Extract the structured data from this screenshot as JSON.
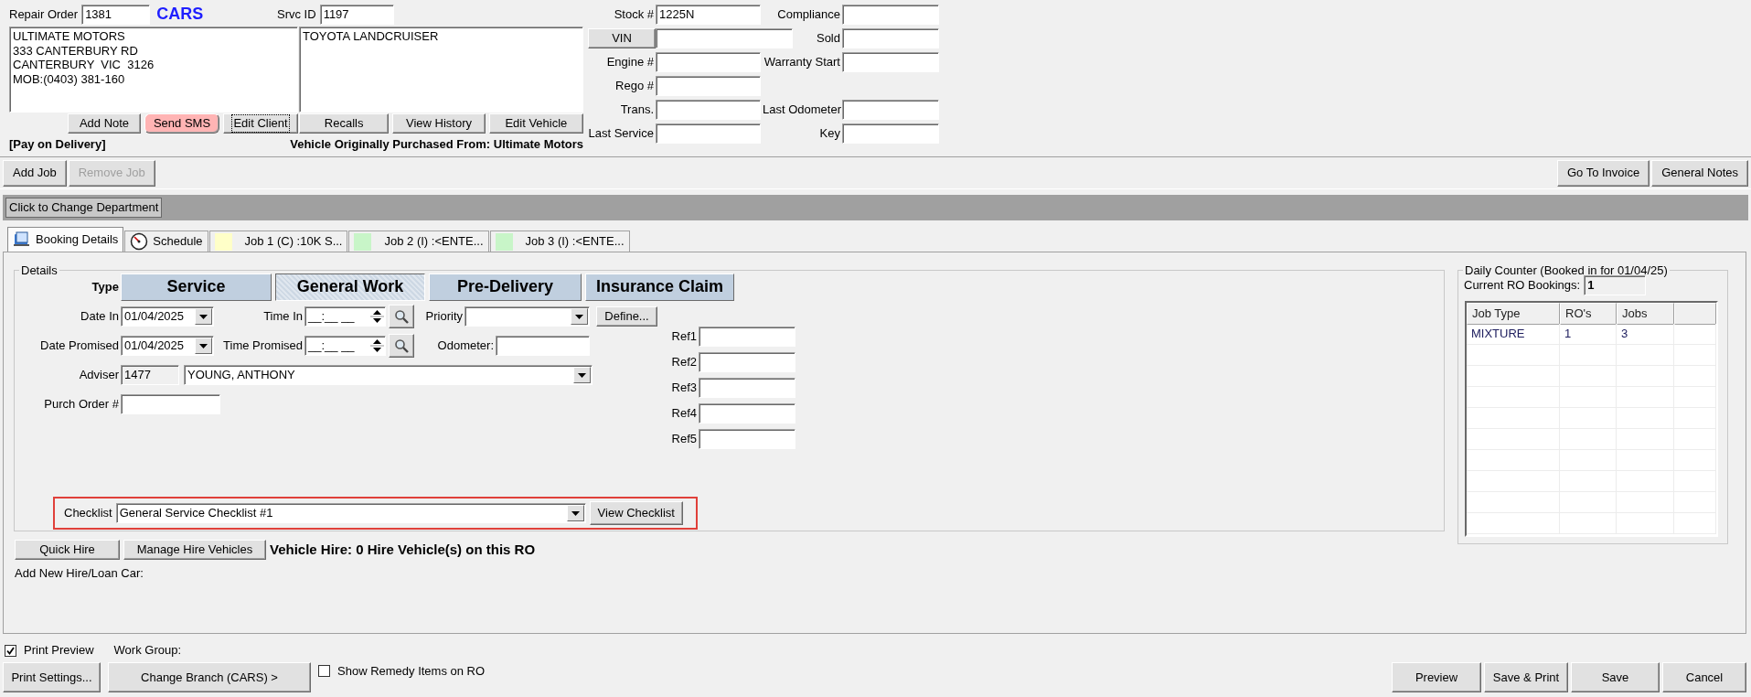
{
  "header": {
    "repair_order_label": "Repair Order",
    "repair_order": "1381",
    "branch": "CARS",
    "srvc_id_label": "Srvc ID",
    "srvc_id": "1197",
    "client_lines": [
      "ULTIMATE MOTORS",
      "333 CANTERBURY RD",
      "CANTERBURY  VIC  3126",
      "MOB:(0403) 381-160"
    ],
    "client_buttons": [
      {
        "label": "Add Note",
        "kind": "plain"
      },
      {
        "label": "Send SMS",
        "kind": "alert"
      },
      {
        "label": "Edit Client",
        "kind": "focused"
      }
    ],
    "payment_note": "[Pay on Delivery]",
    "vehicle_lines": [
      "TOYOTA LANDCRUISER"
    ],
    "vehicle_buttons": [
      {
        "label": "Recalls",
        "kind": "plain"
      },
      {
        "label": "View History",
        "kind": "plain"
      },
      {
        "label": "Edit Vehicle",
        "kind": "plain"
      }
    ],
    "purchased_from": "Vehicle Originally Purchased From: Ultimate Motors"
  },
  "vehicle_rows": [
    {
      "left": {
        "label": "Stock #",
        "kind": "label",
        "value": "1225N"
      },
      "right": {
        "label": "Compliance"
      }
    },
    {
      "left": {
        "label": "VIN",
        "kind": "button"
      },
      "right": {
        "label": "Sold"
      }
    },
    {
      "left": {
        "label": "Engine #",
        "kind": "label"
      },
      "right": {
        "label": "Warranty Start"
      }
    },
    {
      "left": {
        "label": "Rego #",
        "kind": "label"
      }
    },
    {
      "left": {
        "label": "Trans.",
        "kind": "label"
      },
      "right": {
        "label": "Last Odometer"
      }
    },
    {
      "left": {
        "label": "Last Service",
        "kind": "label"
      },
      "right": {
        "label": "Key"
      }
    }
  ],
  "toolbar": {
    "left": [
      {
        "label": "Add Job",
        "disabled": false
      },
      {
        "label": "Remove Job",
        "disabled": true
      }
    ],
    "right": [
      {
        "label": "Go To Invoice",
        "disabled": false
      },
      {
        "label": "General Notes",
        "disabled": false
      }
    ]
  },
  "department_button": "Click to Change Department",
  "tabs": [
    {
      "label": "Booking Details",
      "kind": "booking",
      "selected": true
    },
    {
      "label": "Schedule",
      "kind": "schedule",
      "selected": false
    },
    {
      "label": "Job 1 (C) :10K S...",
      "kind": "job",
      "color": "#ffffc8",
      "selected": false
    },
    {
      "label": "Job 2 (I) :<ENTE...",
      "kind": "job",
      "color": "#c8f5c8",
      "selected": false
    },
    {
      "label": "Job 3 (I) :<ENTE...",
      "kind": "job",
      "color": "#c8f5c8",
      "selected": false
    }
  ],
  "details": {
    "title": "Details",
    "type_label": "Type",
    "types": [
      {
        "label": "Service",
        "selected": false
      },
      {
        "label": "General Work",
        "selected": true
      },
      {
        "label": "Pre-Delivery",
        "selected": false
      },
      {
        "label": "Insurance Claim",
        "selected": false
      }
    ],
    "date_in": {
      "label": "Date In",
      "value": "01/04/2025"
    },
    "time_in": {
      "label": "Time In",
      "value": "__:__ __"
    },
    "priority": {
      "label": "Priority"
    },
    "define_button": "Define...",
    "date_promised": {
      "label": "Date Promised",
      "value": "01/04/2025"
    },
    "time_promised": {
      "label": "Time Promised",
      "value": "__:__ __"
    },
    "odometer": {
      "label": "Odometer:"
    },
    "adviser": {
      "label": "Adviser",
      "code": "1477",
      "name": "YOUNG, ANTHONY"
    },
    "purch_order": {
      "label": "Purch Order #"
    },
    "refs": [
      "Ref1",
      "Ref2",
      "Ref3",
      "Ref4",
      "Ref5"
    ],
    "checklist": {
      "label": "Checklist",
      "value": "General Service Checklist #1",
      "button": "View Checklist",
      "highlighted": true
    }
  },
  "hire": {
    "buttons": [
      "Quick Hire",
      "Manage Hire Vehicles"
    ],
    "summary": "Vehicle Hire: 0 Hire Vehicle(s) on this RO",
    "add_label": "Add New Hire/Loan Car:"
  },
  "daily_counter": {
    "title": "Daily Counter (Booked in for 01/04/25)",
    "bookings_label": "Current RO Bookings:",
    "bookings": "1",
    "columns": [
      "Job Type",
      "RO's",
      "Jobs"
    ],
    "rows": [
      [
        "MIXTURE",
        "1",
        "3"
      ]
    ]
  },
  "footer": {
    "print_preview": {
      "label": "Print Preview",
      "checked": true
    },
    "work_group_label": "Work Group:",
    "left_buttons": [
      "Print Settings...",
      "Change Branch (CARS) >"
    ],
    "remedy": {
      "label": "Show Remedy Items on RO",
      "checked": false
    },
    "right_buttons": [
      "Preview",
      "Save & Print",
      "Save",
      "Cancel"
    ]
  }
}
